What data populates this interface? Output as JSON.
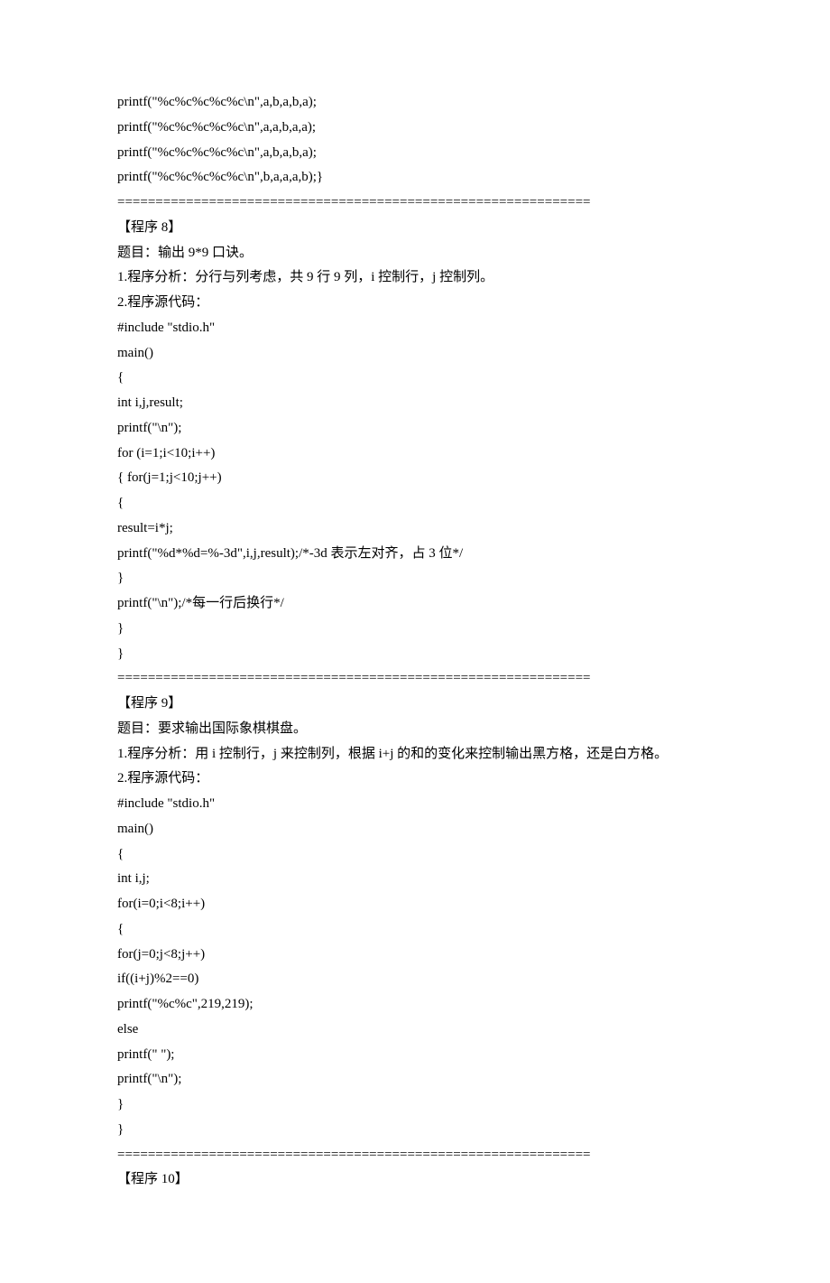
{
  "lines": [
    "printf(\"%c%c%c%c%c\\n\",a,b,a,b,a);",
    "printf(\"%c%c%c%c%c\\n\",a,a,b,a,a);",
    "printf(\"%c%c%c%c%c\\n\",a,b,a,b,a);",
    "printf(\"%c%c%c%c%c\\n\",b,a,a,a,b);}",
    "==============================================================",
    "【程序 8】",
    "题目：输出 9*9 口诀。",
    "1.程序分析：分行与列考虑，共 9 行 9 列，i 控制行，j 控制列。",
    "2.程序源代码：",
    "#include \"stdio.h\"",
    "main()",
    "{",
    "int i,j,result;",
    "printf(\"\\n\");",
    "for (i=1;i<10;i++)",
    "{ for(j=1;j<10;j++)",
    "{",
    "result=i*j;",
    "printf(\"%d*%d=%-3d\",i,j,result);/*-3d 表示左对齐，占 3 位*/",
    "}",
    "printf(\"\\n\");/*每一行后换行*/",
    "}",
    "}",
    "==============================================================",
    "【程序 9】",
    "题目：要求输出国际象棋棋盘。",
    "1.程序分析：用 i 控制行，j 来控制列，根据 i+j 的和的变化来控制输出黑方格，还是白方格。",
    "2.程序源代码：",
    "#include \"stdio.h\"",
    "main()",
    "{",
    "int i,j;",
    "for(i=0;i<8;i++)",
    "{",
    "for(j=0;j<8;j++)",
    "if((i+j)%2==0)",
    "printf(\"%c%c\",219,219);",
    "else",
    "printf(\" \");",
    "printf(\"\\n\");",
    "}",
    "}",
    "==============================================================",
    "【程序 10】"
  ]
}
